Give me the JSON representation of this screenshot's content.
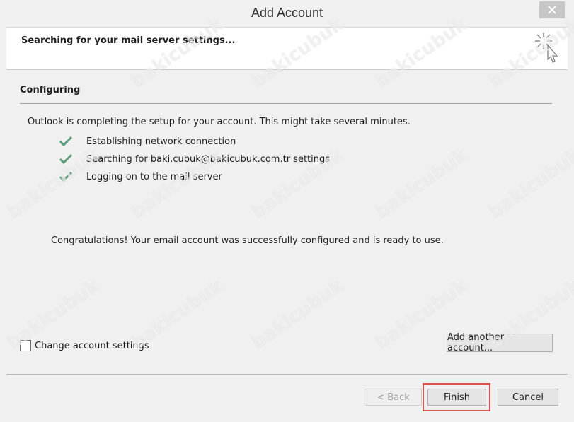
{
  "window": {
    "title": "Add Account"
  },
  "header": {
    "status_text": "Searching for your mail server settings..."
  },
  "section": {
    "title": "Configuring"
  },
  "intro_text": "Outlook is completing the setup for your account. This might take several minutes.",
  "steps": [
    {
      "label": "Establishing network connection",
      "status": "done"
    },
    {
      "label": "Searching for baki.cubuk@bakicubuk.com.tr settings",
      "status": "done"
    },
    {
      "label": "Logging on to the mail server",
      "status": "done"
    }
  ],
  "congratulations_text": "Congratulations! Your email account was successfully configured and is ready to use.",
  "change_settings": {
    "label": "Change account settings",
    "checked": false
  },
  "buttons": {
    "add_another": "Add another account...",
    "back": "< Back",
    "finish": "Finish",
    "cancel": "Cancel"
  },
  "colors": {
    "check_green": "#5c9c7a",
    "highlight_red": "#d9534f"
  },
  "watermark": "bakicubuk"
}
